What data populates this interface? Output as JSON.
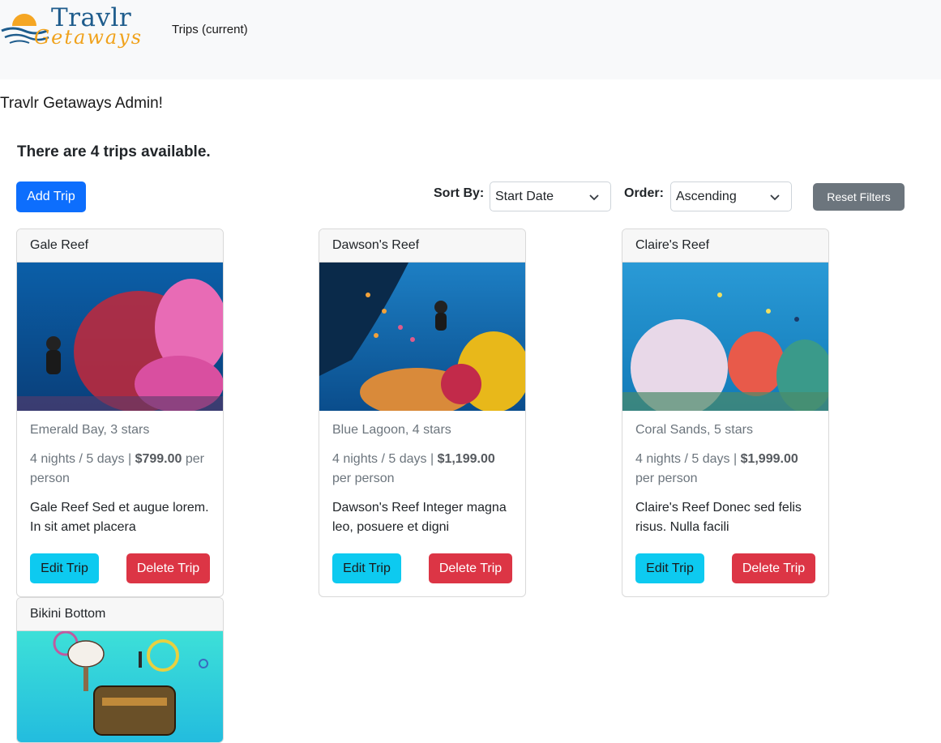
{
  "header": {
    "logo_top": "Travlr",
    "logo_bottom": "Getaways",
    "nav_link": "Trips (current)"
  },
  "welcome": "Travlr Getaways Admin!",
  "trip_count_text": "There are 4 trips available.",
  "toolbar": {
    "add_label": "Add Trip",
    "sort_label": "Sort By:",
    "sort_value": "Start Date",
    "order_label": "Order:",
    "order_value": "Ascending",
    "reset_label": "Reset Filters"
  },
  "trips": [
    {
      "name": "Gale Reef",
      "resort": "Emerald Bay, 3 stars",
      "duration": "4 nights / 5 days | ",
      "price": "$799.00",
      "per": " per person",
      "desc": "Gale Reef Sed et augue lorem. In sit amet placera",
      "edit_label": "Edit Trip",
      "delete_label": "Delete Trip"
    },
    {
      "name": "Dawson's Reef",
      "resort": "Blue Lagoon, 4 stars",
      "duration": "4 nights / 5 days | ",
      "price": "$1,199.00",
      "per": " per person",
      "desc": "Dawson's Reef Integer magna leo, posuere et digni",
      "edit_label": "Edit Trip",
      "delete_label": "Delete Trip"
    },
    {
      "name": "Claire's Reef",
      "resort": "Coral Sands, 5 stars",
      "duration": "4 nights / 5 days | ",
      "price": "$1,999.00",
      "per": " per person",
      "desc": "Claire's Reef Donec sed felis risus. Nulla facili",
      "edit_label": "Edit Trip",
      "delete_label": "Delete Trip"
    },
    {
      "name": "Bikini Bottom"
    }
  ],
  "colors": {
    "primary": "#0d6efd",
    "info": "#0dcaf0",
    "danger": "#dc3545",
    "secondary": "#6c757d",
    "navbar_bg": "#f8f9fa"
  }
}
